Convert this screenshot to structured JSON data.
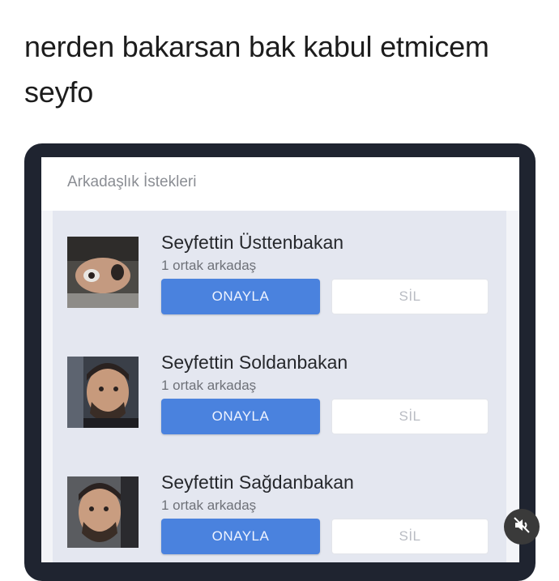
{
  "caption": {
    "line1": "nerden bakarsan bak kabul etmicem",
    "line2": "seyfo"
  },
  "screen": {
    "header_title": "Arkadaşlık İstekleri"
  },
  "requests": [
    {
      "name": "Seyfettin Üsttenbakan",
      "mutual": "1 ortak arkadaş",
      "confirm_label": "ONAYLA",
      "delete_label": "SİL"
    },
    {
      "name": "Seyfettin Soldanbakan",
      "mutual": "1 ortak arkadaş",
      "confirm_label": "ONAYLA",
      "delete_label": "SİL"
    },
    {
      "name": "Seyfettin Sağdanbakan",
      "mutual": "1 ortak arkadaş",
      "confirm_label": "ONAYLA",
      "delete_label": "SİL"
    }
  ],
  "overlay": {
    "icon": "muted-speaker-icon"
  },
  "colors": {
    "confirm": "#4a82de",
    "frame": "#1f2430"
  }
}
